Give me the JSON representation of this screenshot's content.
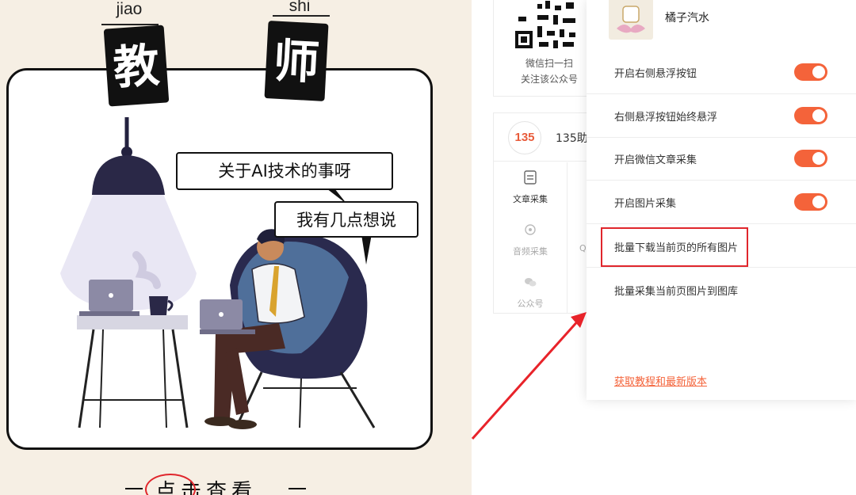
{
  "poster": {
    "pinyin_left": "jiao",
    "pinyin_right": "shi",
    "char_left": "教",
    "char_right": "师",
    "bubble_1": "关于AI技术的事呀",
    "bubble_2": "我有几点想说",
    "cta": "点击查看"
  },
  "qr_card": {
    "line_1": "微信扫一扫",
    "line_2": "关注该公众号"
  },
  "tool_card": {
    "logo_text": "135",
    "name": "135助",
    "grid": [
      {
        "label": "文章采集"
      },
      {
        "label": "音频采集"
      },
      {
        "label": "公众号"
      }
    ],
    "partial_label": "Q"
  },
  "settings_panel": {
    "account_name": "橘子汽水",
    "toggles": [
      {
        "label": "开启右侧悬浮按钮",
        "on": true
      },
      {
        "label": "右侧悬浮按钮始终悬浮",
        "on": true
      },
      {
        "label": "开启微信文章采集",
        "on": true
      },
      {
        "label": "开启图片采集",
        "on": true
      }
    ],
    "action_download": "批量下载当前页的所有图片",
    "action_collect": "批量采集当前页图片到图库",
    "footer_link": "获取教程和最新版本"
  },
  "colors": {
    "accent": "#f4633a",
    "highlight_box": "#e0262c",
    "arrow": "#e8232a"
  }
}
